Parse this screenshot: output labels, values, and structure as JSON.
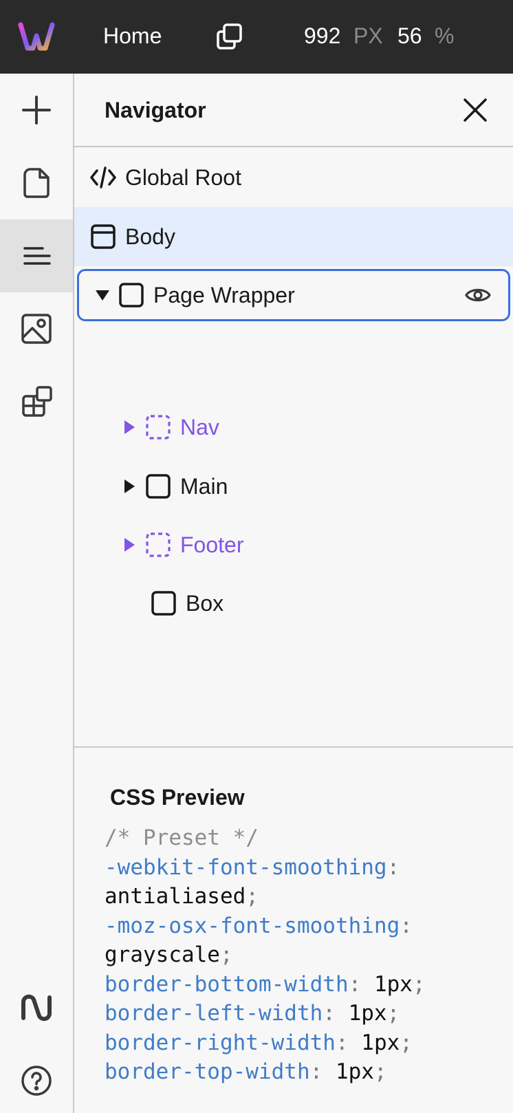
{
  "topbar": {
    "page_name": "Home",
    "width_value": "992",
    "width_unit": "PX",
    "zoom_value": "56",
    "zoom_unit": "%"
  },
  "rail": {
    "items": [
      {
        "icon": "plus-icon"
      },
      {
        "icon": "page-icon"
      },
      {
        "icon": "navigator-icon",
        "active": true
      },
      {
        "icon": "image-icon"
      },
      {
        "icon": "components-icon"
      },
      {
        "icon": "logo-mark-icon"
      },
      {
        "icon": "help-icon"
      }
    ]
  },
  "navigator": {
    "title": "Navigator",
    "tree": {
      "global_root": "Global Root",
      "body": "Body",
      "page_wrapper": "Page Wrapper",
      "nav": "Nav",
      "main": "Main",
      "footer": "Footer",
      "box": "Box"
    }
  },
  "css_preview": {
    "title": "CSS Preview",
    "comment": "/* Preset */",
    "lines": [
      {
        "prop": "-webkit-font-smoothing",
        "value": "antialiased"
      },
      {
        "prop": "-moz-osx-font-smoothing",
        "value": "grayscale"
      },
      {
        "prop": "border-bottom-width",
        "value": "1px"
      },
      {
        "prop": "border-left-width",
        "value": "1px"
      },
      {
        "prop": "border-right-width",
        "value": "1px"
      },
      {
        "prop": "border-top-width",
        "value": "1px"
      }
    ]
  },
  "colors": {
    "topbar_bg": "#2a2a2a",
    "selection_bg": "#e3edfb",
    "focus_border": "#3a6fde",
    "component_purple": "#8155e6",
    "css_property": "#3f7cc8"
  }
}
